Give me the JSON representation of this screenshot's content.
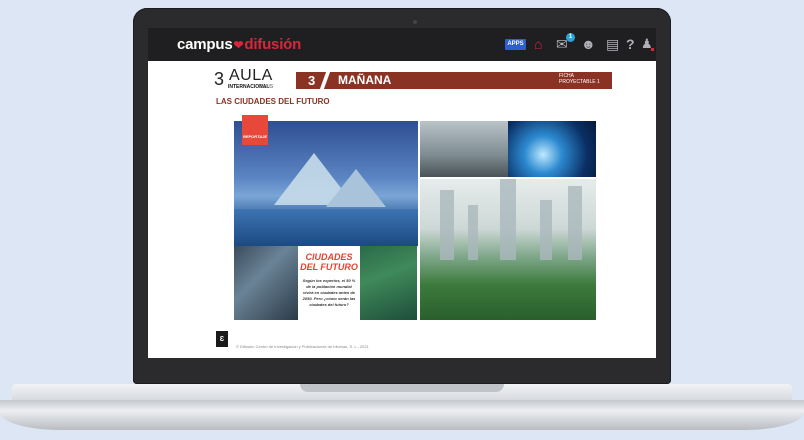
{
  "app": {
    "logo_part1": "campus",
    "logo_heart": "❤",
    "logo_part2": "difusión",
    "apps_label": "APPS",
    "mail_badge": "1",
    "help_label": "?"
  },
  "icons": [
    "home-icon",
    "mail-icon",
    "users-icon",
    "card-icon",
    "help-icon",
    "user-icon"
  ],
  "document": {
    "book_number": "3",
    "book_name": "AULA",
    "book_sub": "INTERNACIONAL",
    "book_plus": "PLUS",
    "unit_number": "3",
    "unit_title": "MAÑANA",
    "ficha_line1": "FICHA",
    "ficha_line2": "PROYECTABLE 1",
    "section_title": "LAS CIUDADES DEL FUTURO",
    "reportaje": "REPORTAJE",
    "feature_title": "CIUDADES DEL FUTURO",
    "feature_text": "Según los expertos, el 50 % de la población mundial vivirá en ciudades antes de 2050. Pero ¿cómo serán las ciudades del futuro?",
    "footer_logo": "Ɛ",
    "copyright": "© Difusión Centro de Investigación y Publicaciones de Idiomas, S. L., 2021"
  },
  "colors": {
    "brand_red": "#d8263b",
    "unit_bar": "#8a3324",
    "apps_blue": "#2d5fd0"
  }
}
